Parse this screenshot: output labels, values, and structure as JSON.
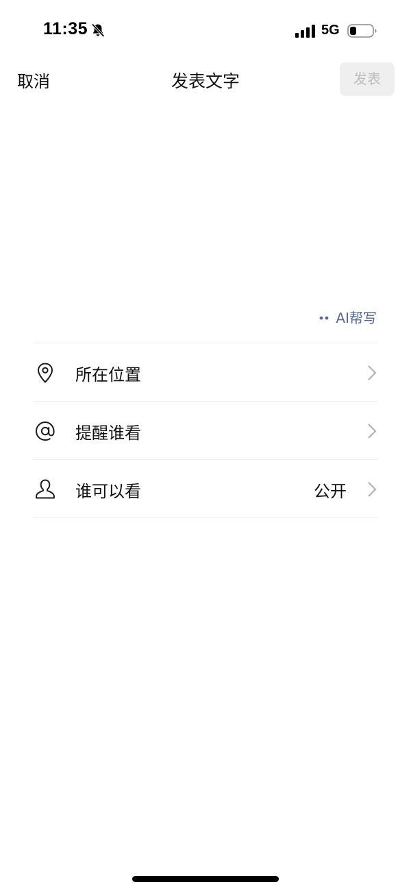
{
  "status_bar": {
    "time": "11:35",
    "network": "5G"
  },
  "nav": {
    "cancel_label": "取消",
    "title": "发表文字",
    "publish_label": "发表"
  },
  "editor": {
    "value": "",
    "placeholder": ""
  },
  "ai_helper": {
    "label": "AI帮写"
  },
  "options": [
    {
      "label": "所在位置",
      "value": "",
      "icon": "location-pin-icon"
    },
    {
      "label": "提醒谁看",
      "value": "",
      "icon": "at-sign-icon"
    },
    {
      "label": "谁可以看",
      "value": "公开",
      "icon": "person-icon"
    }
  ],
  "colors": {
    "link": "#576b95",
    "disabled_button_bg": "#efefef",
    "disabled_button_text": "#bdbdbd",
    "divider": "#ececec",
    "chevron": "#b2b2b2"
  }
}
